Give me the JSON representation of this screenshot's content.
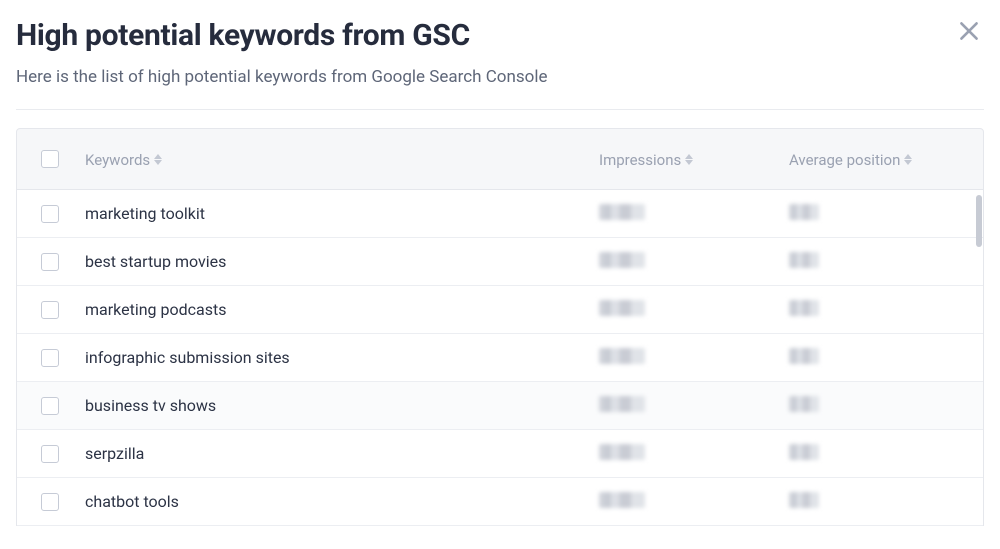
{
  "header": {
    "title": "High potential keywords from GSC",
    "subtitle": "Here is the list of high potential keywords from Google Search Console"
  },
  "table": {
    "columns": {
      "keywords": "Keywords",
      "impressions": "Impressions",
      "avg_position": "Average position"
    },
    "rows": [
      {
        "keyword": "marketing toolkit"
      },
      {
        "keyword": "best startup movies"
      },
      {
        "keyword": "marketing podcasts"
      },
      {
        "keyword": "infographic submission sites"
      },
      {
        "keyword": "business tv shows"
      },
      {
        "keyword": "serpzilla"
      },
      {
        "keyword": "chatbot tools"
      }
    ]
  }
}
